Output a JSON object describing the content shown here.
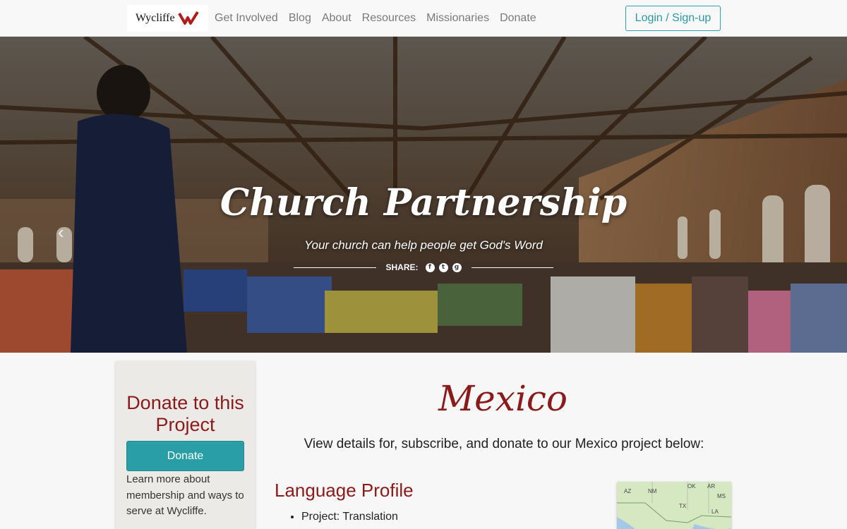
{
  "header": {
    "logo_text": "Wycliffe",
    "nav": [
      "Get Involved",
      "Blog",
      "About",
      "Resources",
      "Missionaries",
      "Donate"
    ],
    "login_label": "Login / Sign-up"
  },
  "hero": {
    "title": "Church Partnership",
    "subtitle": "Your church can help people get God's Word",
    "share_label": "SHARE:",
    "share_icons": [
      "facebook-icon",
      "twitter-icon",
      "google-plus-icon"
    ]
  },
  "sidebar": {
    "heading": "Donate to this Project",
    "donate_label": "Donate",
    "learn_text": "Learn more about membership and ways to serve at Wycliffe."
  },
  "main": {
    "title": "Mexico",
    "subtitle": "View details for, subscribe, and donate to our Mexico project below:",
    "language_profile": "Language Profile",
    "profile_items": [
      "Project: Translation"
    ]
  },
  "map": {
    "labels": [
      "AZ",
      "NM",
      "OK",
      "AR",
      "MS",
      "TX",
      "LA"
    ]
  },
  "colors": {
    "accent": "#8b1a1a",
    "teal": "#2a9ea6"
  }
}
